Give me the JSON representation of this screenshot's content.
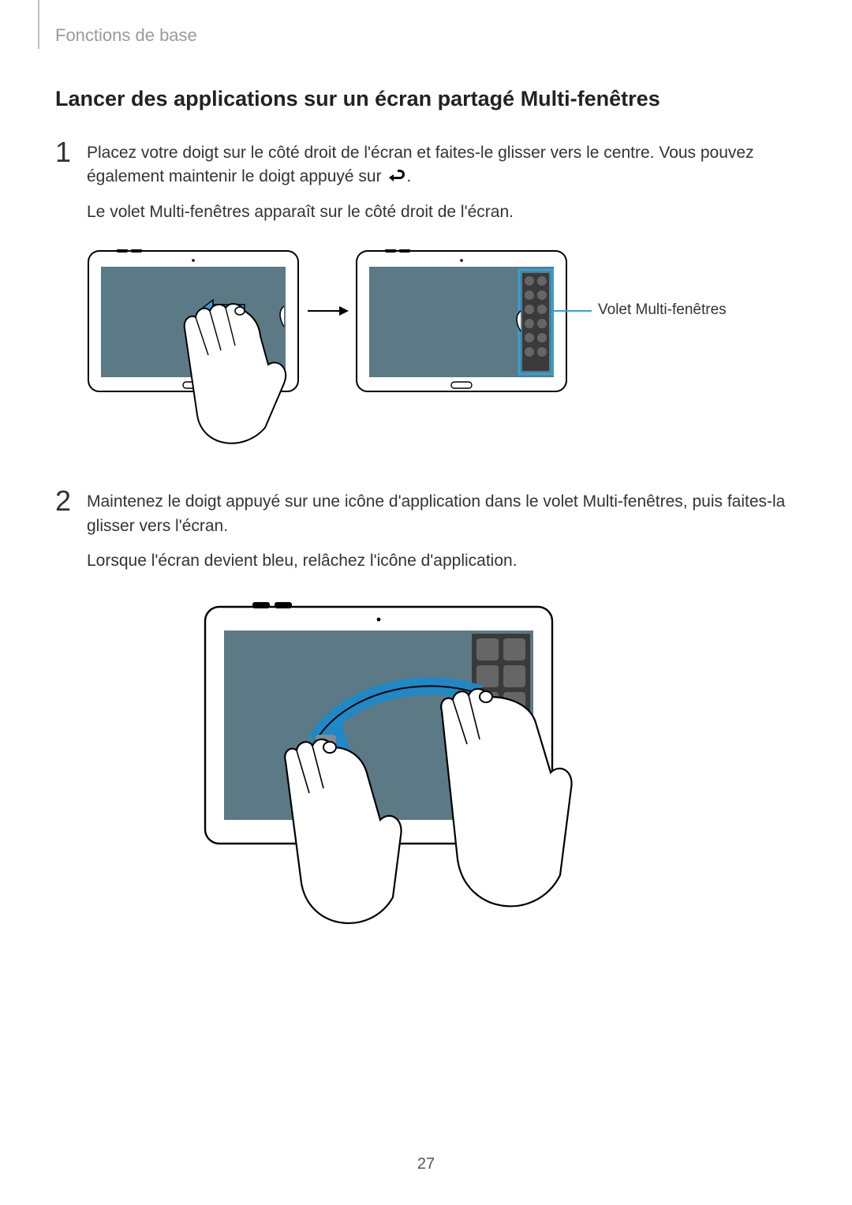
{
  "header": {
    "breadcrumb": "Fonctions de base"
  },
  "section": {
    "title": "Lancer des applications sur un écran partagé Multi-fenêtres"
  },
  "steps": [
    {
      "num": "1",
      "para1_a": "Placez votre doigt sur le côté droit de l'écran et faites-le glisser vers le centre. Vous pouvez également maintenir le doigt appuyé sur ",
      "para1_b": ".",
      "para2": "Le volet Multi-fenêtres apparaît sur le côté droit de l'écran."
    },
    {
      "num": "2",
      "para1": "Maintenez le doigt appuyé sur une icône d'application dans le volet Multi-fenêtres, puis faites-la glisser vers l'écran.",
      "para2": "Lorsque l'écran devient bleu, relâchez l'icône d'application."
    }
  ],
  "callout": {
    "label": "Volet Multi-fenêtres"
  },
  "page_number": "27",
  "icons": {
    "back": "back-icon"
  }
}
